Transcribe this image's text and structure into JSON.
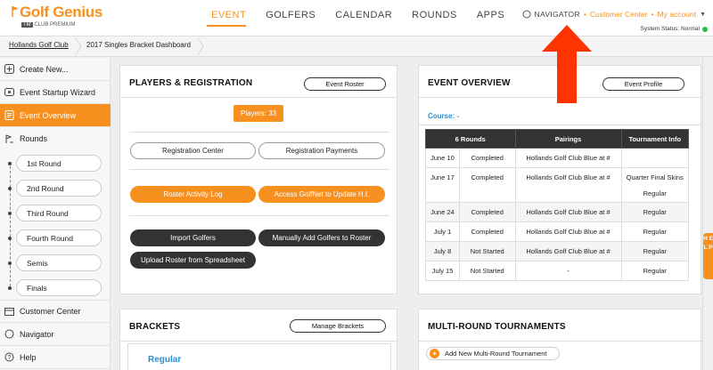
{
  "header": {
    "logo_text": "Golf Genius",
    "logo_tm": "TM",
    "logo_sub": "CLUB PREMIUM",
    "nav": [
      "EVENT",
      "GOLFERS",
      "CALENDAR",
      "ROUNDS",
      "APPS"
    ],
    "active_nav": "EVENT",
    "navigator_label": "NAVIGATOR",
    "customer_center_label": "Customer Center",
    "my_account_label": "My account",
    "system_status": "System Status: Normal"
  },
  "breadcrumb": [
    "Hollands Golf Club",
    "2017 Singles Bracket Dashboard"
  ],
  "sidebar": {
    "items": [
      {
        "label": "Create New...",
        "icon": "plus-icon"
      },
      {
        "label": "Event Startup Wizard",
        "icon": "wizard-icon"
      },
      {
        "label": "Event Overview",
        "icon": "overview-icon"
      },
      {
        "label": "Rounds",
        "icon": "rounds-icon"
      }
    ],
    "rounds": [
      "1st Round",
      "2nd Round",
      "Third Round",
      "Fourth Round",
      "Semis",
      "Finals"
    ],
    "bottom_items": [
      {
        "label": "Customer Center",
        "icon": "customer-center-icon"
      },
      {
        "label": "Navigator",
        "icon": "navigator-icon"
      },
      {
        "label": "Help",
        "icon": "help-icon"
      }
    ]
  },
  "players_panel": {
    "title": "PLAYERS & REGISTRATION",
    "roster_button": "Event Roster",
    "players_count": "Players: 33",
    "registration_center": "Registration Center",
    "registration_payments": "Registration Payments",
    "roster_activity_log": "Roster Activity Log",
    "access_golfnet": "Access GolfNet to Update H.I.",
    "import_golfers": "Import Golfers",
    "manually_add": "Manually Add Golfers to Roster",
    "upload_roster": "Upload Roster from Spreadsheet"
  },
  "overview_panel": {
    "title": "EVENT OVERVIEW",
    "profile_button": "Event Profile",
    "course": "Course: -",
    "columns": [
      "6 Rounds",
      "Pairings",
      "Tournament Info"
    ],
    "rows": [
      {
        "date": "June 10",
        "status": "Completed",
        "pairings": "Hollands Golf Club Blue at #",
        "info": ""
      },
      {
        "date": "June 17",
        "status": "Completed",
        "pairings": "Hollands Golf Club Blue at #",
        "info": "Quarter Final Skins",
        "info2": "Regular"
      },
      {
        "date": "June 24",
        "status": "Completed",
        "pairings": "Hollands Golf Club Blue at #",
        "info": "Regular"
      },
      {
        "date": "July 1",
        "status": "Completed",
        "pairings": "Hollands Golf Club Blue at #",
        "info": "Regular"
      },
      {
        "date": "July 8",
        "status": "Not Started",
        "pairings": "Hollands Golf Club Blue at #",
        "info": "Regular"
      },
      {
        "date": "July 15",
        "status": "Not Started",
        "pairings": "-",
        "info": "Regular"
      }
    ]
  },
  "brackets_panel": {
    "title": "BRACKETS",
    "manage_button": "Manage Brackets",
    "regular_link": "Regular"
  },
  "multi_round_panel": {
    "title": "MULTI-ROUND TOURNAMENTS",
    "add_button": "Add New Multi-Round Tournament"
  },
  "side_tab_text": "H E L P",
  "colors": {
    "accent": "#f7901e",
    "dark": "#333333",
    "link": "#2b8fd0",
    "status_ok": "#2db84a",
    "arrow": "#ff3300"
  }
}
